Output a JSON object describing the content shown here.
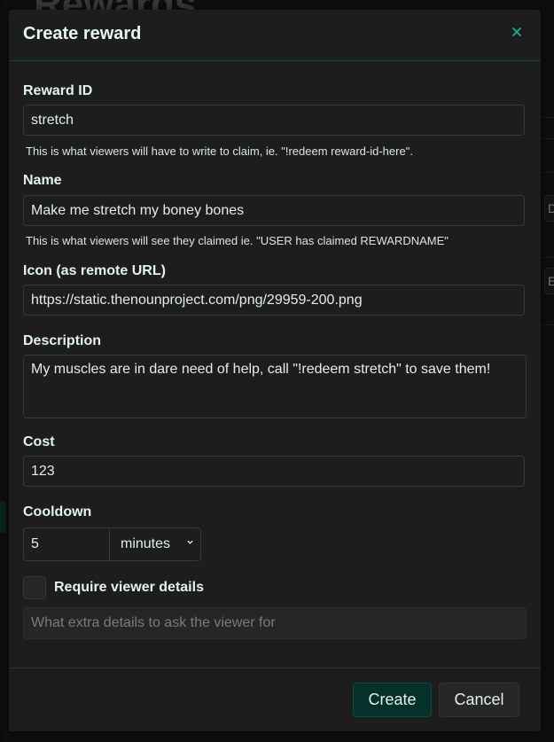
{
  "background": {
    "page_title_fragment": "Rewards",
    "right_rail_letters": [
      "D",
      "E"
    ]
  },
  "modal": {
    "title": "Create reward",
    "close_icon": "close-icon",
    "accent_color": "#17b39a",
    "fields": {
      "reward_id": {
        "label": "Reward ID",
        "value": "stretch",
        "help": "This is what viewers will have to write to claim, ie. \"!redeem reward-id-here\"."
      },
      "name": {
        "label": "Name",
        "value": "Make me stretch my boney bones",
        "help": "This is what viewers will see they claimed ie. \"USER has claimed REWARDNAME\""
      },
      "icon_url": {
        "label": "Icon (as remote URL)",
        "value": "https://static.thenounproject.com/png/29959-200.png"
      },
      "description": {
        "label": "Description",
        "value": "My muscles are in dare need of help, call \"!redeem stretch\" to save them!"
      },
      "cost": {
        "label": "Cost",
        "value": "123"
      },
      "cooldown": {
        "label": "Cooldown",
        "value": "5",
        "unit_selected": "minutes"
      },
      "require_viewer_details": {
        "label": "Require viewer details",
        "checked": false,
        "placeholder": "What extra details to ask the viewer for",
        "value": ""
      }
    },
    "buttons": {
      "create": "Create",
      "cancel": "Cancel"
    }
  }
}
